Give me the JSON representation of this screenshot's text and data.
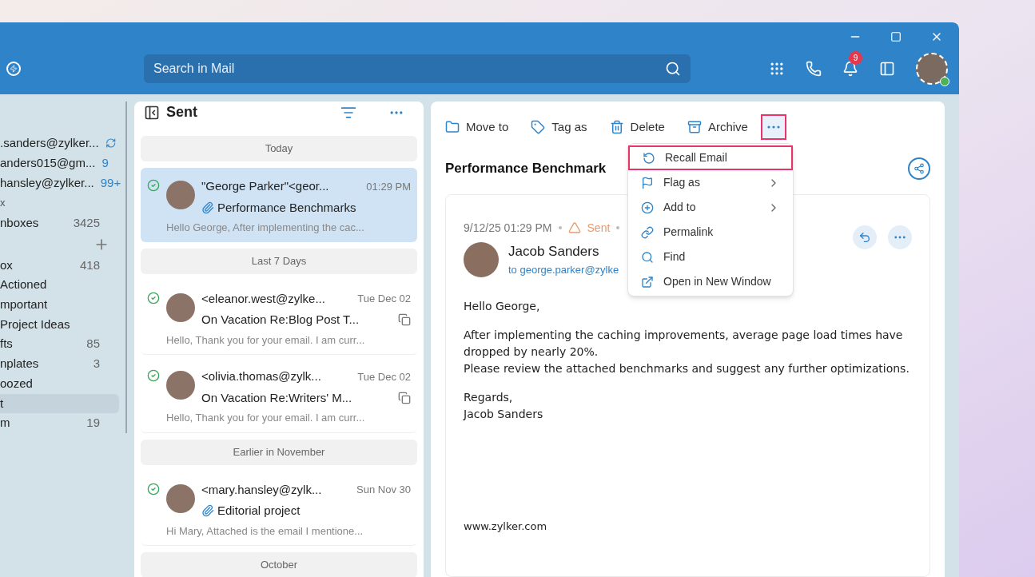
{
  "search": {
    "placeholder": "Search in Mail"
  },
  "notifications": {
    "badge": "9"
  },
  "sidebar": {
    "items": [
      {
        "kind": "account",
        "label": ".sanders@zylker..."
      },
      {
        "kind": "account",
        "label": "anders015@gm...",
        "count": "9"
      },
      {
        "kind": "account",
        "label": "hansley@zylker...",
        "count": "99+"
      },
      {
        "kind": "section",
        "label": "x"
      },
      {
        "kind": "folder",
        "label": "nboxes",
        "count": "3425",
        "selected": false
      },
      {
        "kind": "add"
      },
      {
        "kind": "folder",
        "label": "ox",
        "count": "418",
        "selected": false
      },
      {
        "kind": "folder",
        "label": "Actioned",
        "selected": false
      },
      {
        "kind": "folder",
        "label": "mportant",
        "selected": false
      },
      {
        "kind": "folder",
        "label": "Project Ideas",
        "selected": false
      },
      {
        "kind": "folder",
        "label": "fts",
        "count": "85",
        "selected": false
      },
      {
        "kind": "folder",
        "label": "nplates",
        "count": "3",
        "selected": false
      },
      {
        "kind": "folder",
        "label": "oozed",
        "selected": false
      },
      {
        "kind": "folder",
        "label": "t",
        "selected": true
      },
      {
        "kind": "folder",
        "label": "m",
        "count": "19",
        "selected": false
      }
    ]
  },
  "list": {
    "title": "Sent",
    "entries": [
      {
        "kind": "group",
        "label": "Today"
      },
      {
        "kind": "mail",
        "sender": "\"George Parker\"<geor...",
        "time": "01:29 PM",
        "attachment": true,
        "thread": false,
        "subject": "Performance Benchmarks",
        "preview": "Hello George,  After implementing the cac...",
        "selected": true
      },
      {
        "kind": "group",
        "label": "Last 7 Days"
      },
      {
        "kind": "mail",
        "sender": "<eleanor.west@zylke...",
        "time": "Tue Dec 02",
        "attachment": false,
        "thread": true,
        "subject": "On Vacation Re:Blog Post T...",
        "preview": "Hello, Thank you for your email. I am curr...",
        "selected": false
      },
      {
        "kind": "mail",
        "sender": "<olivia.thomas@zylk...",
        "time": "Tue Dec 02",
        "attachment": false,
        "thread": true,
        "subject": "On Vacation Re:Writers' M...",
        "preview": "Hello, Thank you for your email. I am curr...",
        "selected": false
      },
      {
        "kind": "group",
        "label": "Earlier in November"
      },
      {
        "kind": "mail",
        "sender": "<mary.hansley@zylk...",
        "time": "Sun Nov 30",
        "attachment": true,
        "thread": false,
        "subject": "Editorial project",
        "preview": "Hi Mary, Attached is the email I mentione...",
        "selected": false
      },
      {
        "kind": "group",
        "label": "October"
      }
    ]
  },
  "toolbar": {
    "actions": [
      {
        "kind": "move",
        "label": "Move to"
      },
      {
        "kind": "tag",
        "label": "Tag as"
      },
      {
        "kind": "delete",
        "label": "Delete"
      },
      {
        "kind": "archive",
        "label": "Archive"
      }
    ],
    "more_highlighted": true
  },
  "menu": {
    "items": [
      {
        "kind": "recall",
        "label": "Recall Email",
        "submenu": false,
        "highlighted": true
      },
      {
        "kind": "flag",
        "label": "Flag as",
        "submenu": true,
        "highlighted": false
      },
      {
        "kind": "add",
        "label": "Add to",
        "submenu": true,
        "highlighted": false
      },
      {
        "kind": "link",
        "label": "Permalink",
        "submenu": false,
        "highlighted": false
      },
      {
        "kind": "find",
        "label": "Find",
        "submenu": false,
        "highlighted": false
      },
      {
        "kind": "window",
        "label": "Open in New Window",
        "submenu": false,
        "highlighted": false
      }
    ]
  },
  "message": {
    "subject": "Performance Benchmark",
    "date": "9/12/25 01:29 PM",
    "status": "Sent",
    "sender": "Jacob Sanders",
    "to": "to george.parker@zylke",
    "body": [
      "Hello George,",
      "After implementing the caching improvements, average page load times have dropped by nearly 20%.\nPlease review the attached benchmarks and suggest any further optimizations.",
      "Regards,\nJacob Sanders"
    ],
    "footer": "www.zylker.com"
  }
}
